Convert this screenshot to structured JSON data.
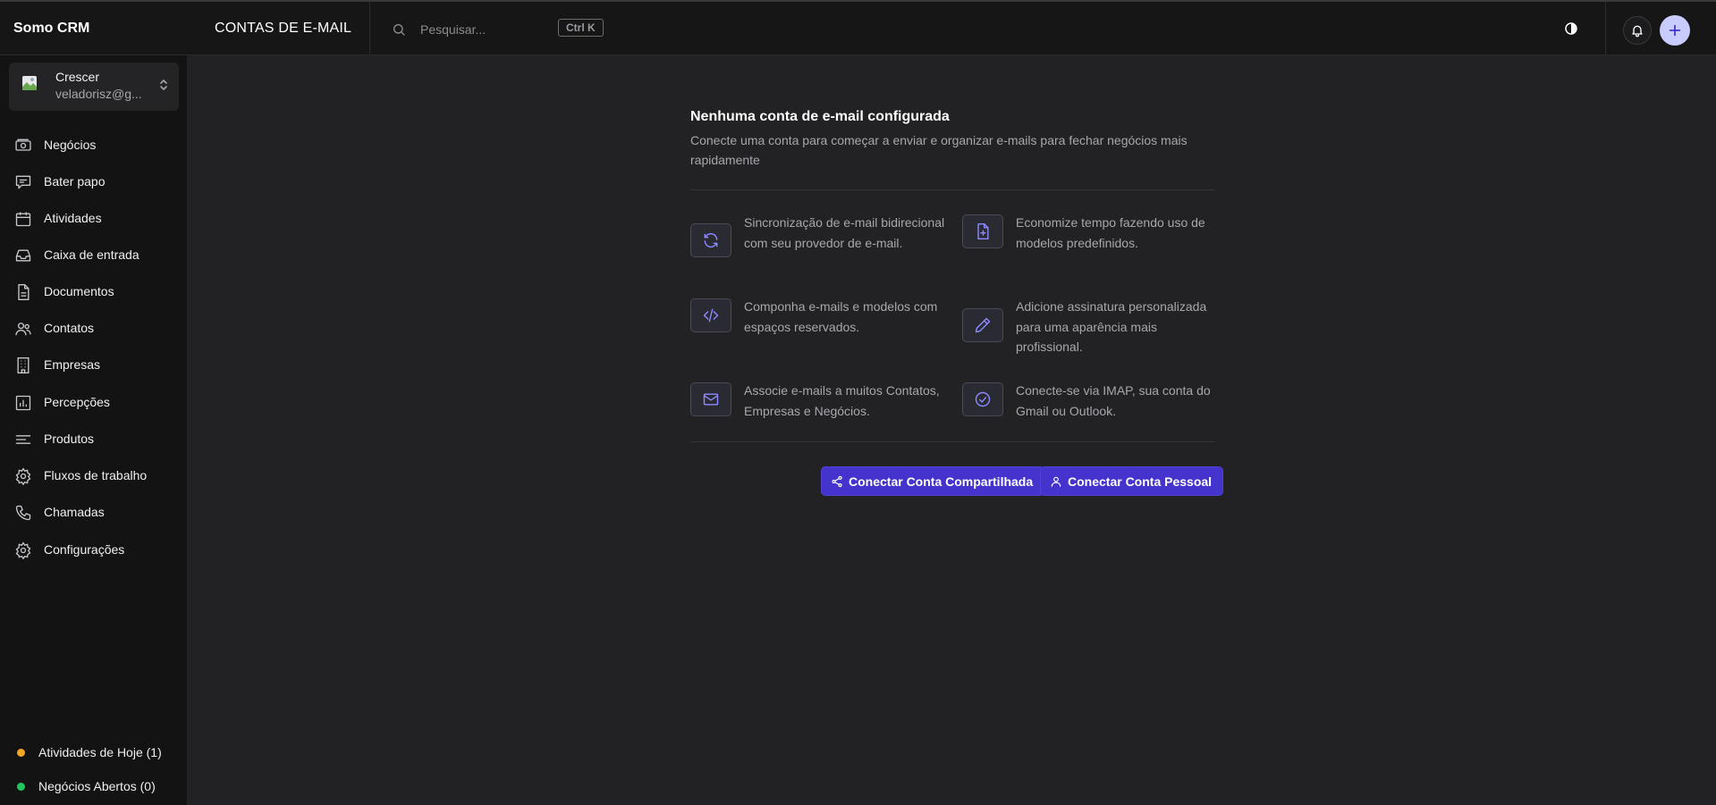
{
  "app": {
    "brand": "Somo CRM",
    "page_title": "CONTAS DE E-MAIL"
  },
  "search": {
    "placeholder": "Pesquisar...",
    "shortcut": "Ctrl K"
  },
  "workspace": {
    "name": "Crescer",
    "email": "veladorisz@g..."
  },
  "sidebar": {
    "items": [
      {
        "label": "Negócios",
        "icon": "deals-icon"
      },
      {
        "label": "Bater papo",
        "icon": "chat-icon"
      },
      {
        "label": "Atividades",
        "icon": "calendar-icon"
      },
      {
        "label": "Caixa de entrada",
        "icon": "inbox-icon"
      },
      {
        "label": "Documentos",
        "icon": "document-icon"
      },
      {
        "label": "Contatos",
        "icon": "contacts-icon"
      },
      {
        "label": "Empresas",
        "icon": "building-icon"
      },
      {
        "label": "Percepções",
        "icon": "chart-icon"
      },
      {
        "label": "Produtos",
        "icon": "list-icon"
      },
      {
        "label": "Fluxos de trabalho",
        "icon": "workflow-gear-icon"
      },
      {
        "label": "Chamadas",
        "icon": "phone-icon"
      },
      {
        "label": "Configurações",
        "icon": "settings-gear-icon"
      }
    ],
    "status": [
      {
        "label": "Atividades de Hoje (1)",
        "color": "#f5a524"
      },
      {
        "label": "Negócios Abertos (0)",
        "color": "#22c55e"
      }
    ]
  },
  "main": {
    "title": "Nenhuma conta de e-mail configurada",
    "description": "Conecte uma conta para começar a enviar e organizar e-mails para fechar negócios mais rapidamente",
    "features": [
      {
        "text": "Sincronização de e-mail bidirecional com seu provedor de e-mail.",
        "icon": "sync-icon"
      },
      {
        "text": "Economize tempo fazendo uso de modelos predefinidos.",
        "icon": "file-plus-icon"
      },
      {
        "text": "Componha e-mails e modelos com espaços reservados.",
        "icon": "code-icon"
      },
      {
        "text": "Adicione assinatura personalizada para uma aparência mais profissional.",
        "icon": "pencil-icon"
      },
      {
        "text": "Associe e-mails a muitos Contatos, Empresas e Negócios.",
        "icon": "mail-icon"
      },
      {
        "text": "Conecte-se via IMAP, sua conta do Gmail ou Outlook.",
        "icon": "check-circle-icon"
      }
    ],
    "buttons": {
      "shared": "Conectar Conta Compartilhada",
      "personal": "Conectar Conta Pessoal"
    }
  },
  "colors": {
    "accent": "#4433cc",
    "icon_accent": "#8b8bff"
  }
}
